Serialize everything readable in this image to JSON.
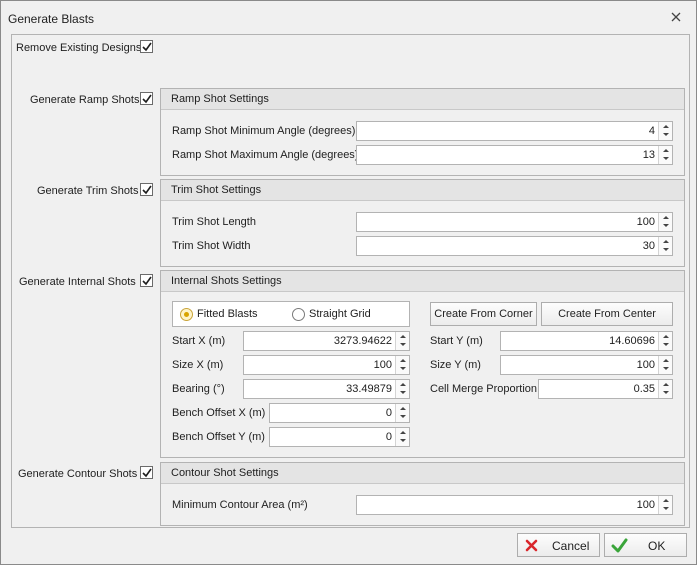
{
  "window": {
    "title": "Generate Blasts"
  },
  "remove_existing": {
    "label": "Remove Existing Designs",
    "checked": true
  },
  "ramp": {
    "toggle_label": "Generate Ramp Shots",
    "group_title": "Ramp Shot Settings",
    "min_angle_label": "Ramp Shot Minimum Angle (degrees)",
    "min_angle_value": "4",
    "max_angle_label": "Ramp Shot Maximum Angle (degrees)",
    "max_angle_value": "13"
  },
  "trim": {
    "toggle_label": "Generate Trim Shots",
    "group_title": "Trim Shot Settings",
    "length_label": "Trim Shot Length",
    "length_value": "100",
    "width_label": "Trim Shot Width",
    "width_value": "30"
  },
  "internal": {
    "toggle_label": "Generate Internal Shots",
    "group_title": "Internal Shots Settings",
    "mode_options": [
      "Fitted Blasts",
      "Straight Grid"
    ],
    "mode_selected": "Fitted Blasts",
    "create_corner_label": "Create From Corner",
    "create_center_label": "Create From Center",
    "start_x_label": "Start X (m)",
    "start_x_value": "3273.94622",
    "start_y_label": "Start Y (m)",
    "start_y_value": "14.60696",
    "size_x_label": "Size X (m)",
    "size_x_value": "100",
    "size_y_label": "Size Y (m)",
    "size_y_value": "100",
    "bearing_label": "Bearing (°)",
    "bearing_value": "33.49879",
    "cell_merge_label": "Cell Merge Proportion",
    "cell_merge_value": "0.35",
    "bench_x_label": "Bench Offset X (m)",
    "bench_x_value": "0",
    "bench_y_label": "Bench Offset Y (m)",
    "bench_y_value": "0"
  },
  "contour": {
    "toggle_label": "Generate Contour Shots",
    "group_title": "Contour Shot Settings",
    "min_area_label": "Minimum Contour Area (m²)",
    "min_area_value": "100"
  },
  "footer": {
    "cancel_label": "Cancel",
    "ok_label": "OK"
  },
  "colors": {
    "accent_check": "#1e1e1e",
    "cancel_icon": "#d9262b",
    "ok_icon": "#3aa53a"
  }
}
